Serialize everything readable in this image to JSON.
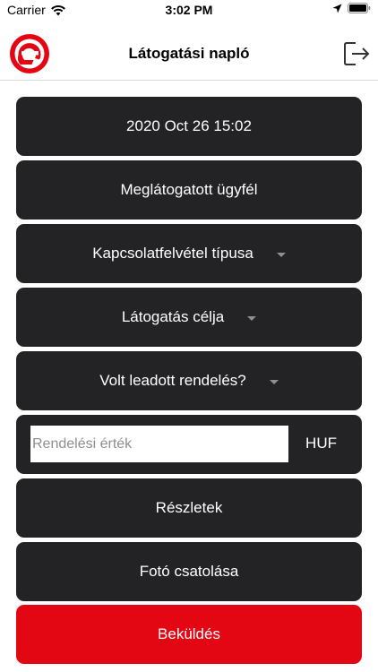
{
  "status_bar": {
    "carrier": "Carrier",
    "time": "3:02 PM",
    "icons": [
      "wifi-icon",
      "location-arrow-icon",
      "battery-icon"
    ]
  },
  "nav": {
    "title": "Látogatási napló",
    "logo_icon": "e-logo",
    "logout_icon": "logout-icon"
  },
  "form": {
    "datetime": "2020 Oct 26 15:02",
    "client": "Meglátogatott ügyfél",
    "contact_type": "Kapcsolatfelvétel típusa",
    "visit_purpose": "Látogatás célja",
    "order_placed": "Volt leadott rendelés?",
    "order_value_placeholder": "Rendelési érték",
    "order_value": "",
    "currency": "HUF",
    "details": "Részletek",
    "attach_photo": "Fotó csatolása",
    "submit": "Beküldés"
  },
  "colors": {
    "row_background": "#232325",
    "accent": "#e30613",
    "text_on_dark": "#ffffff"
  }
}
